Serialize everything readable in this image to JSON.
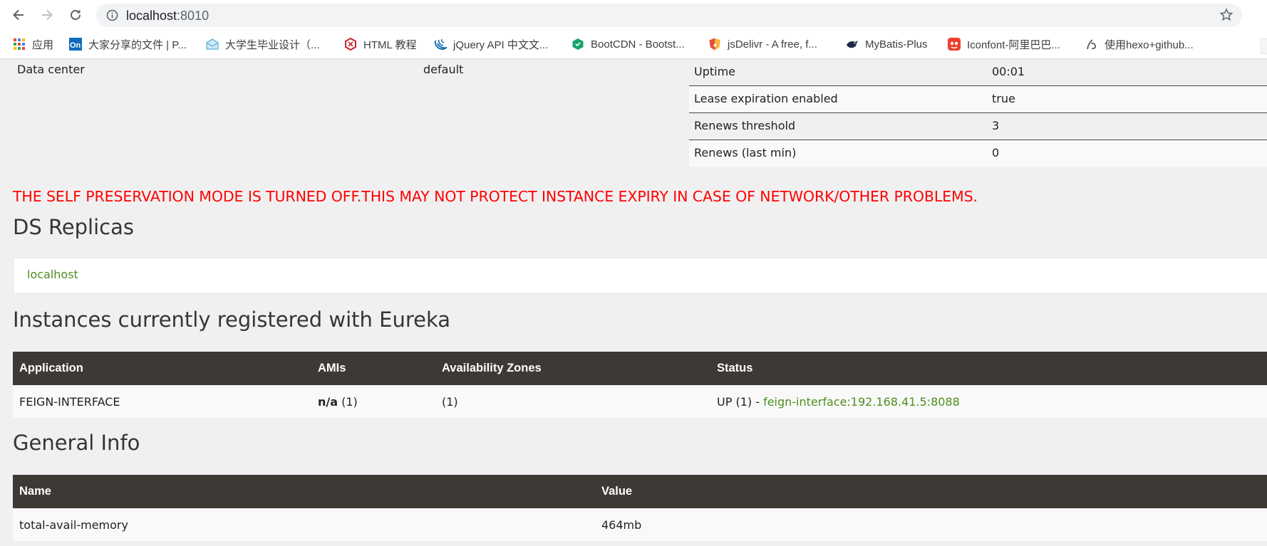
{
  "browser": {
    "url_host": "localhost",
    "url_port": ":8010",
    "bookmarks": [
      {
        "label": "应用",
        "icon": "apps-grid-icon",
        "color": "#4285f4"
      },
      {
        "label": "大家分享的文件 | P...",
        "icon": "onedrive-on-icon",
        "color": "#0f6cbd"
      },
      {
        "label": "大学生毕业设计（...",
        "icon": "envelope-icon",
        "color": "#7ac0e8"
      },
      {
        "label": "HTML 教程",
        "icon": "runoob-icon",
        "color": "#c2272d"
      },
      {
        "label": "jQuery API 中文文...",
        "icon": "jquery-icon",
        "color": "#0868ac"
      },
      {
        "label": "BootCDN - Bootst...",
        "icon": "bootcdn-icon",
        "color": "#1aa46d"
      },
      {
        "label": "jsDelivr - A free, f...",
        "icon": "jsdelivr-shield-icon",
        "color": "#e84d3d"
      },
      {
        "label": "MyBatis-Plus",
        "icon": "bird-icon",
        "color": "#1e2a4a"
      },
      {
        "label": "Iconfont-阿里巴巴...",
        "icon": "iconfont-icon",
        "color": "#f03d2e"
      },
      {
        "label": "使用hexo+github...",
        "icon": "hexo-icon",
        "color": "#555555"
      }
    ]
  },
  "env": {
    "data_center_label": "Data center",
    "data_center_value": "default"
  },
  "status": [
    {
      "key": "Uptime",
      "value": "00:01"
    },
    {
      "key": "Lease expiration enabled",
      "value": "true"
    },
    {
      "key": "Renews threshold",
      "value": "3"
    },
    {
      "key": "Renews (last min)",
      "value": "0"
    }
  ],
  "warning": "THE SELF PRESERVATION MODE IS TURNED OFF.THIS MAY NOT PROTECT INSTANCE EXPIRY IN CASE OF NETWORK/OTHER PROBLEMS.",
  "replicas": {
    "title": "DS Replicas",
    "items": [
      "localhost"
    ]
  },
  "instances": {
    "title": "Instances currently registered with Eureka",
    "headers": [
      "Application",
      "AMIs",
      "Availability Zones",
      "Status"
    ],
    "rows": [
      {
        "application": "FEIGN-INTERFACE",
        "amis_bold": "n/a",
        "amis_count": " (1)",
        "zones": "(1)",
        "status_prefix": "UP (1) - ",
        "status_link": "feign-interface:192.168.41.5:8088"
      }
    ]
  },
  "general": {
    "title": "General Info",
    "headers": [
      "Name",
      "Value"
    ],
    "rows": [
      {
        "name": "total-avail-memory",
        "value": "464mb"
      }
    ]
  }
}
